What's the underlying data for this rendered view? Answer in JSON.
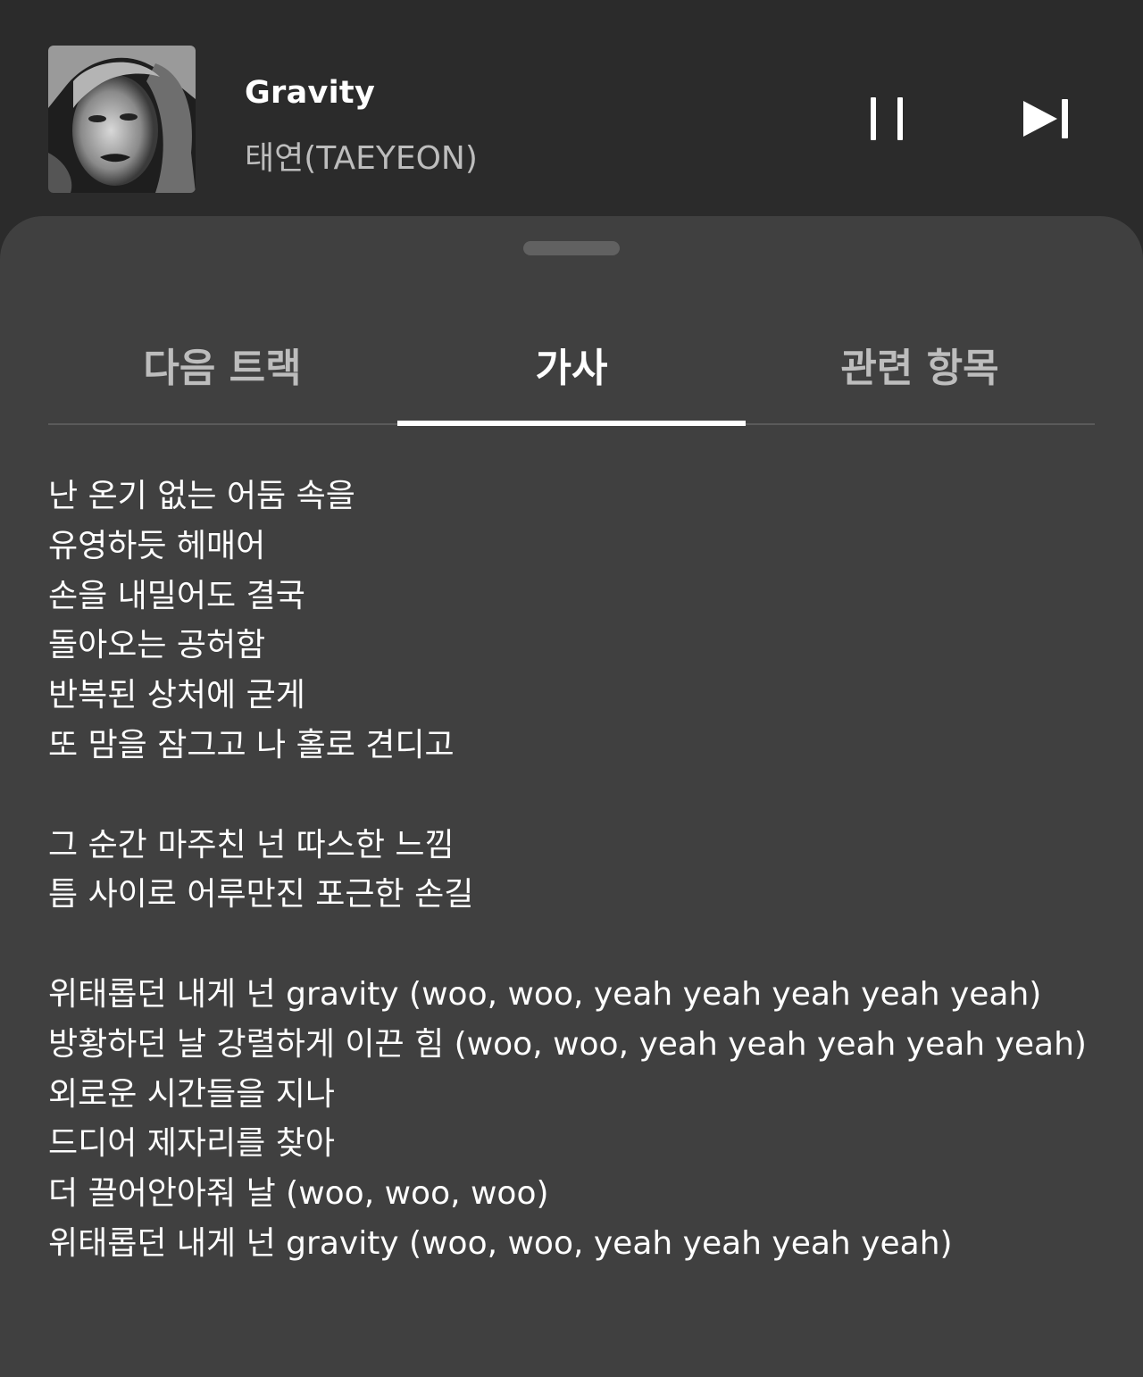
{
  "now_playing": {
    "title": "Gravity",
    "artist": "태연(TAEYEON)",
    "album_art": "album-cover-portrait"
  },
  "controls": {
    "pause_icon": "pause-icon",
    "next_icon": "skip-next-icon"
  },
  "tabs": [
    {
      "label": "다음 트랙",
      "active": false
    },
    {
      "label": "가사",
      "active": true
    },
    {
      "label": "관련 항목",
      "active": false
    }
  ],
  "lyrics": [
    "난 온기 없는 어둠 속을",
    "유영하듯 헤매어",
    "손을 내밀어도 결국",
    "돌아오는 공허함",
    "반복된 상처에 굳게",
    "또 맘을 잠그고 나 홀로 견디고",
    "",
    "그 순간 마주친 넌 따스한 느낌",
    "틈 사이로 어루만진 포근한 손길",
    "",
    "위태롭던 내게 넌 gravity (woo, woo, yeah yeah yeah yeah yeah)",
    "방황하던 날 강렬하게 이끈 힘 (woo, woo, yeah yeah yeah yeah yeah)",
    "외로운 시간들을 지나",
    "드디어 제자리를 찾아",
    "더 끌어안아줘 날 (woo, woo, woo)",
    "위태롭던 내게 넌 gravity (woo, woo, yeah yeah yeah yeah)"
  ],
  "colors": {
    "player_bg": "#2b2b2b",
    "sheet_bg": "#404040",
    "text_primary": "#ffffff",
    "text_secondary": "#bdbdbd"
  }
}
